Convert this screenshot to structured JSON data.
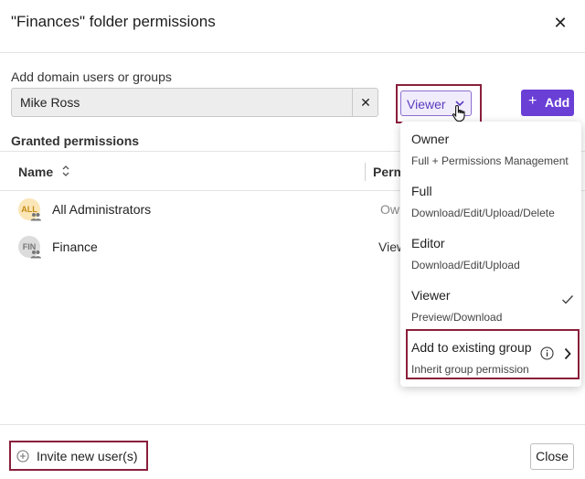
{
  "dialog": {
    "title": "\"Finances\" folder permissions",
    "close_symbol": "✕"
  },
  "add_users": {
    "label": "Add domain users or groups",
    "input_value": "Mike Ross",
    "clear_symbol": "✕",
    "role_value": "Viewer",
    "add_label": "Add",
    "add_symbol": "+"
  },
  "granted": {
    "heading": "Granted permissions",
    "columns": {
      "name": "Name",
      "permission": "Perm"
    },
    "rows": [
      {
        "avatar_text": "ALL",
        "name": "All Administrators",
        "permission": "Owr"
      },
      {
        "avatar_text": "FIN",
        "name": "Finance",
        "permission": "View"
      }
    ]
  },
  "role_menu": {
    "items": [
      {
        "title": "Owner",
        "desc": "Full + Permissions Management"
      },
      {
        "title": "Full",
        "desc": "Download/Edit/Upload/Delete"
      },
      {
        "title": "Editor",
        "desc": "Download/Edit/Upload"
      },
      {
        "title": "Viewer",
        "desc": "Preview/Download",
        "selected": true
      },
      {
        "title": "Add to existing group",
        "desc": "Inherit group permission"
      }
    ]
  },
  "footer": {
    "invite_label": "Invite new user(s)",
    "close_label": "Close"
  },
  "colors": {
    "accent": "#6a3fd6",
    "highlight_border": "#8a1f3b"
  }
}
